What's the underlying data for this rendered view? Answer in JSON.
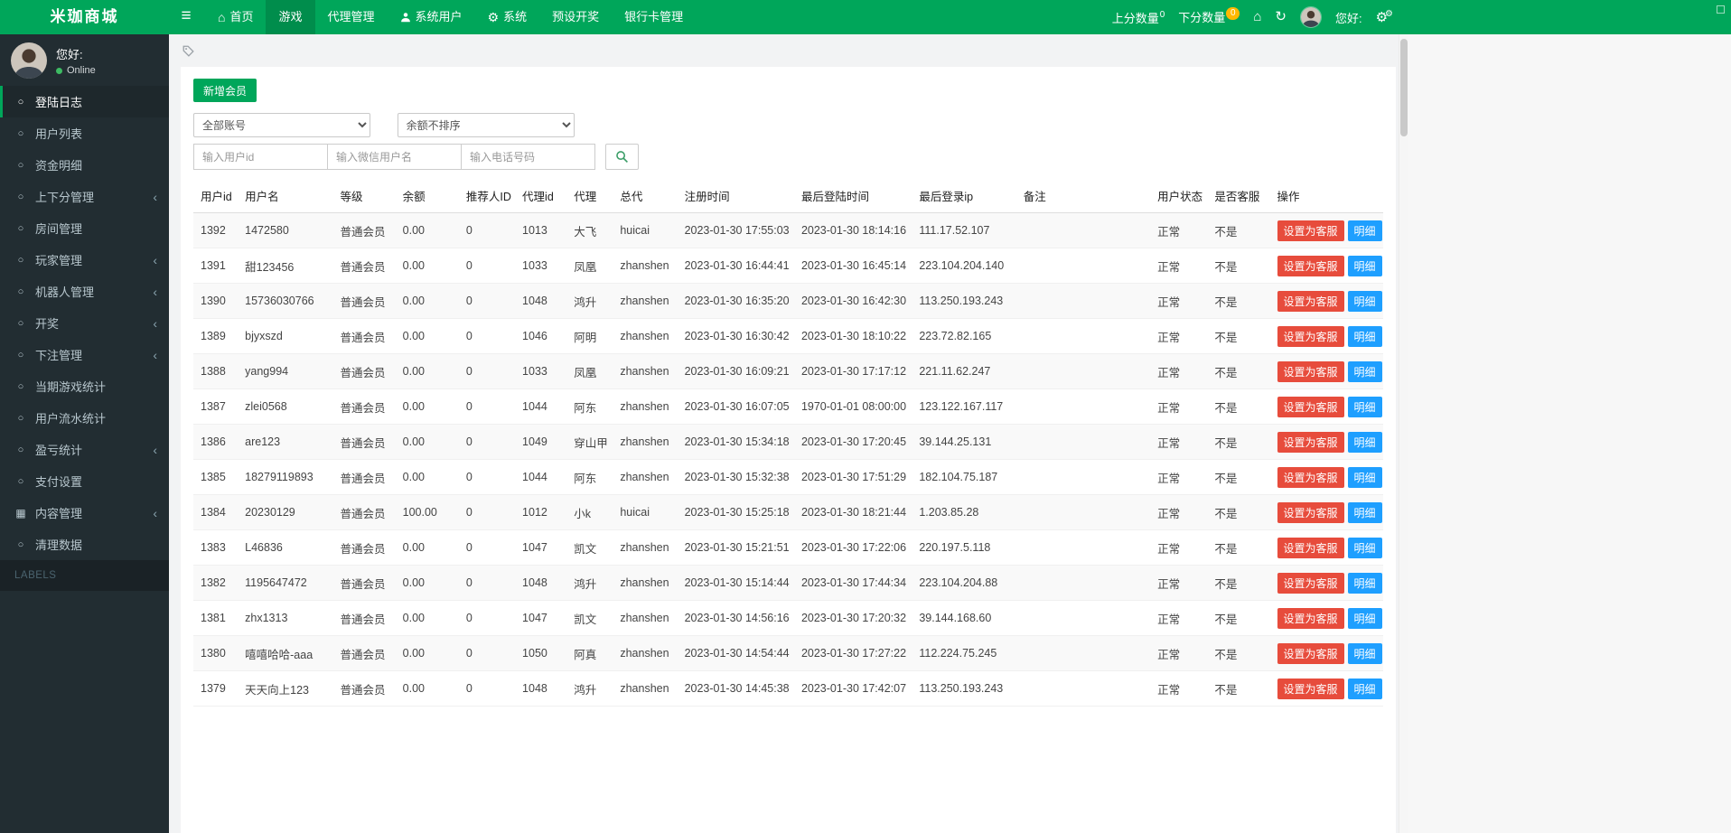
{
  "header": {
    "logo": "米珈商城",
    "nav": [
      {
        "label": "首页",
        "icon": "home",
        "active": false
      },
      {
        "label": "游戏",
        "active": true
      },
      {
        "label": "代理管理",
        "active": false
      },
      {
        "label": "系统用户",
        "icon": "user",
        "active": false
      },
      {
        "label": "系统",
        "icon": "gear",
        "active": false
      },
      {
        "label": "预设开奖",
        "active": false
      },
      {
        "label": "银行卡管理",
        "active": false
      }
    ],
    "score_up": {
      "label": "上分数量",
      "badge": "0"
    },
    "score_down": {
      "label": "下分数量",
      "badge": "0"
    },
    "greeting": "您好:"
  },
  "sidebar": {
    "greeting": "您好:",
    "status": "Online",
    "items": [
      {
        "label": "登陆日志",
        "icon": "circle",
        "active": true,
        "has_children": false
      },
      {
        "label": "用户列表",
        "icon": "circle",
        "active": false,
        "has_children": false
      },
      {
        "label": "资金明细",
        "icon": "circle",
        "active": false,
        "has_children": false
      },
      {
        "label": "上下分管理",
        "icon": "circle",
        "active": false,
        "has_children": true
      },
      {
        "label": "房间管理",
        "icon": "circle",
        "active": false,
        "has_children": false
      },
      {
        "label": "玩家管理",
        "icon": "circle",
        "active": false,
        "has_children": true
      },
      {
        "label": "机器人管理",
        "icon": "circle",
        "active": false,
        "has_children": true
      },
      {
        "label": "开奖",
        "icon": "circle",
        "active": false,
        "has_children": true
      },
      {
        "label": "下注管理",
        "icon": "circle",
        "active": false,
        "has_children": true
      },
      {
        "label": "当期游戏统计",
        "icon": "circle",
        "active": false,
        "has_children": false
      },
      {
        "label": "用户流水统计",
        "icon": "circle",
        "active": false,
        "has_children": false
      },
      {
        "label": "盈亏统计",
        "icon": "circle",
        "active": false,
        "has_children": true
      },
      {
        "label": "支付设置",
        "icon": "circle",
        "active": false,
        "has_children": false
      },
      {
        "label": "内容管理",
        "icon": "grid",
        "active": false,
        "has_children": true
      },
      {
        "label": "清理数据",
        "icon": "circle",
        "active": false,
        "has_children": false
      }
    ],
    "section_label": "LABELS"
  },
  "toolbar": {
    "add_member": "新增会员",
    "account_filter": "全部账号",
    "balance_sort": "余额不排序",
    "ph_userid": "输入用户id",
    "ph_wechat": "输入微信用户名",
    "ph_phone": "输入电话号码"
  },
  "table": {
    "headers": [
      "用户id",
      "用户名",
      "等级",
      "余额",
      "推荐人ID",
      "代理id",
      "代理",
      "总代",
      "注册时间",
      "最后登陆时间",
      "最后登录ip",
      "备注",
      "用户状态",
      "是否客服",
      "操作"
    ],
    "actions": {
      "set_service": "设置为客服",
      "detail": "明细"
    },
    "rows": [
      [
        "1392",
        "1472580",
        "普通会员",
        "0.00",
        "0",
        "1013",
        "大飞",
        "huicai",
        "2023-01-30 17:55:03",
        "2023-01-30 18:14:16",
        "111.17.52.107",
        "",
        "正常",
        "不是"
      ],
      [
        "1391",
        "甜123456",
        "普通会员",
        "0.00",
        "0",
        "1033",
        "凤凰",
        "zhanshen",
        "2023-01-30 16:44:41",
        "2023-01-30 16:45:14",
        "223.104.204.140",
        "",
        "正常",
        "不是"
      ],
      [
        "1390",
        "15736030766",
        "普通会员",
        "0.00",
        "0",
        "1048",
        "鸿升",
        "zhanshen",
        "2023-01-30 16:35:20",
        "2023-01-30 16:42:30",
        "113.250.193.243",
        "",
        "正常",
        "不是"
      ],
      [
        "1389",
        "bjyxszd",
        "普通会员",
        "0.00",
        "0",
        "1046",
        "阿明",
        "zhanshen",
        "2023-01-30 16:30:42",
        "2023-01-30 18:10:22",
        "223.72.82.165",
        "",
        "正常",
        "不是"
      ],
      [
        "1388",
        "yang994",
        "普通会员",
        "0.00",
        "0",
        "1033",
        "凤凰",
        "zhanshen",
        "2023-01-30 16:09:21",
        "2023-01-30 17:17:12",
        "221.11.62.247",
        "",
        "正常",
        "不是"
      ],
      [
        "1387",
        "zlei0568",
        "普通会员",
        "0.00",
        "0",
        "1044",
        "阿东",
        "zhanshen",
        "2023-01-30 16:07:05",
        "1970-01-01 08:00:00",
        "123.122.167.117",
        "",
        "正常",
        "不是"
      ],
      [
        "1386",
        "are123",
        "普通会员",
        "0.00",
        "0",
        "1049",
        "穿山甲",
        "zhanshen",
        "2023-01-30 15:34:18",
        "2023-01-30 17:20:45",
        "39.144.25.131",
        "",
        "正常",
        "不是"
      ],
      [
        "1385",
        "18279119893",
        "普通会员",
        "0.00",
        "0",
        "1044",
        "阿东",
        "zhanshen",
        "2023-01-30 15:32:38",
        "2023-01-30 17:51:29",
        "182.104.75.187",
        "",
        "正常",
        "不是"
      ],
      [
        "1384",
        "20230129",
        "普通会员",
        "100.00",
        "0",
        "1012",
        "小k",
        "huicai",
        "2023-01-30 15:25:18",
        "2023-01-30 18:21:44",
        "1.203.85.28",
        "",
        "正常",
        "不是"
      ],
      [
        "1383",
        "L46836",
        "普通会员",
        "0.00",
        "0",
        "1047",
        "凯文",
        "zhanshen",
        "2023-01-30 15:21:51",
        "2023-01-30 17:22:06",
        "220.197.5.118",
        "",
        "正常",
        "不是"
      ],
      [
        "1382",
        "1195647472",
        "普通会员",
        "0.00",
        "0",
        "1048",
        "鸿升",
        "zhanshen",
        "2023-01-30 15:14:44",
        "2023-01-30 17:44:34",
        "223.104.204.88",
        "",
        "正常",
        "不是"
      ],
      [
        "1381",
        "zhx1313",
        "普通会员",
        "0.00",
        "0",
        "1047",
        "凯文",
        "zhanshen",
        "2023-01-30 14:56:16",
        "2023-01-30 17:20:32",
        "39.144.168.60",
        "",
        "正常",
        "不是"
      ],
      [
        "1380",
        "嘻嘻哈哈-aaa",
        "普通会员",
        "0.00",
        "0",
        "1050",
        "阿真",
        "zhanshen",
        "2023-01-30 14:54:44",
        "2023-01-30 17:27:22",
        "112.224.75.245",
        "",
        "正常",
        "不是"
      ],
      [
        "1379",
        "天天向上123",
        "普通会员",
        "0.00",
        "0",
        "1048",
        "鸿升",
        "zhanshen",
        "2023-01-30 14:45:38",
        "2023-01-30 17:42:07",
        "113.250.193.243",
        "",
        "正常",
        "不是"
      ]
    ]
  }
}
